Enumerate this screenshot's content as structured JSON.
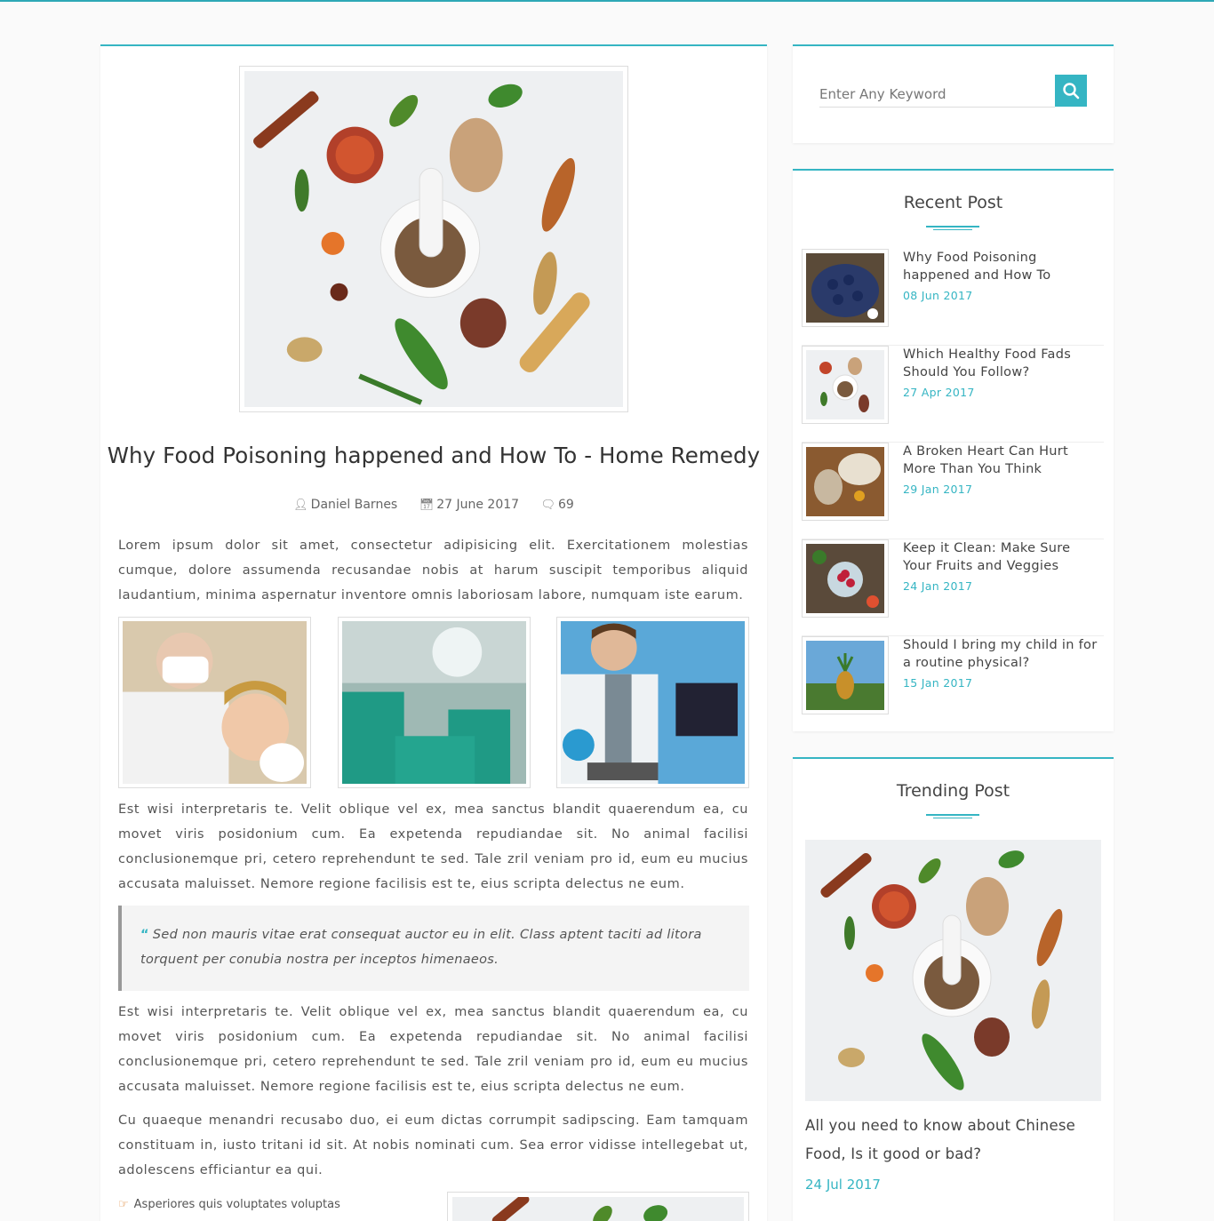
{
  "colors": {
    "accent": "#35b5c3",
    "quote_bar": "#999999",
    "bullet_icon": "#e08a3c"
  },
  "post": {
    "title": "Why Food Poisoning happened and How To - Home Remedy",
    "author": "Daniel Barnes",
    "date": "27 June 2017",
    "comments": "69",
    "paragraph1": "Lorem ipsum dolor sit amet, consectetur adipisicing elit. Exercitationem molestias cumque, dolore assumenda recusandae nobis at harum suscipit temporibus aliquid laudantium, minima aspernatur inventore omnis laboriosam labore, numquam iste earum.",
    "paragraph2": "Est wisi interpretaris te. Velit oblique vel ex, mea sanctus blandit quaerendum ea, cu movet viris posidonium cum. Ea expetenda repudiandae sit. No animal facilisi conclusionemque pri, cetero reprehendunt te sed. Tale zril veniam pro id, eum eu mucius accusata maluisset. Nemore regione facilisis est te, eius scripta delectus ne eum.",
    "quote": "Sed non mauris vitae erat consequat auctor eu in elit. Class aptent taciti ad litora torquent per conubia nostra per inceptos himenaeos.",
    "paragraph3": "Est wisi interpretaris te. Velit oblique vel ex, mea sanctus blandit quaerendum ea, cu movet viris posidonium cum. Ea expetenda repudiandae sit. No animal facilisi conclusionemque pri, cetero reprehendunt te sed. Tale zril veniam pro id, eum eu mucius accusata maluisset. Nemore regione facilisis est te, eius scripta delectus ne eum.",
    "paragraph4": "Cu quaeque menandri recusabo duo, ei eum dictas corrumpit sadipscing. Eam tamquam constituam in, iusto tritani id sit. At nobis nominati cum. Sea error vidisse intellegebat ut, adolescens efficiantur ea qui.",
    "bullet1": "Asperiores quis voluptates voluptas"
  },
  "search": {
    "placeholder": "Enter Any Keyword"
  },
  "recent": {
    "title": "Recent Post",
    "items": [
      {
        "title": "Why Food Poisoning happened and How To",
        "date": "08 Jun 2017"
      },
      {
        "title": "Which Healthy Food Fads Should You Follow?",
        "date": "27 Apr 2017"
      },
      {
        "title": "A Broken Heart Can Hurt More Than You Think",
        "date": "29 Jan 2017"
      },
      {
        "title": "Keep it Clean: Make Sure Your Fruits and Veggies",
        "date": "24 Jan 2017"
      },
      {
        "title": "Should I bring my child in for a routine physical?",
        "date": "15 Jan 2017"
      }
    ]
  },
  "trending": {
    "title": "Trending Post",
    "post_title": "All you need to know about Chinese Food, Is it good or bad?",
    "date": "24 Jul 2017"
  }
}
